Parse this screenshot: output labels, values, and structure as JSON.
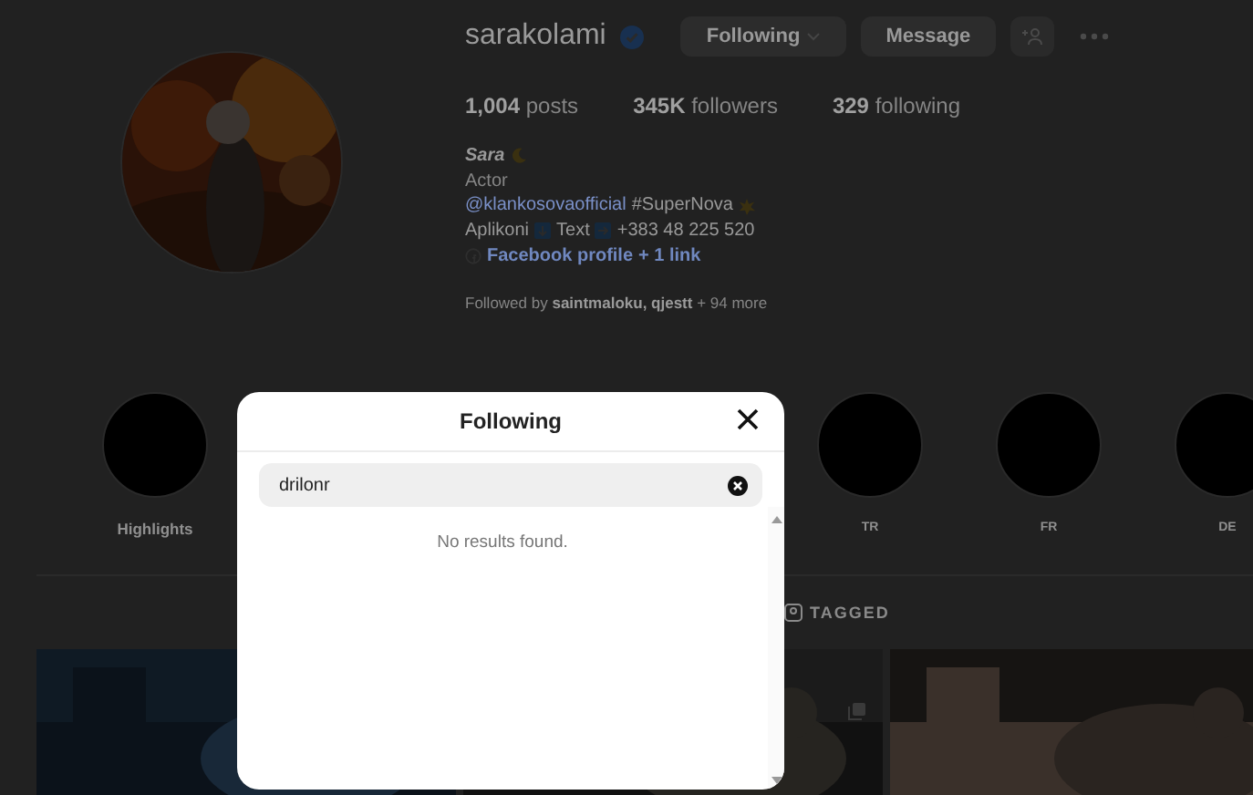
{
  "profile": {
    "username": "sarakolami",
    "verified": true,
    "buttons": [
      {
        "label": "Following",
        "kind": "dropdown"
      },
      {
        "label": "Message",
        "kind": "plain"
      }
    ],
    "stats": [
      {
        "value": "1,004",
        "label": "posts"
      },
      {
        "value": "345K",
        "label": "followers"
      },
      {
        "value": "329",
        "label": "following"
      }
    ],
    "bio": {
      "name": "Sara",
      "category": "Actor",
      "mention": "@klankosovaofficial",
      "hashtag": "#SuperNova",
      "contact": [
        "Aplikoni",
        "Text",
        "+383 48 225 520"
      ],
      "link": "Facebook profile",
      "link_more": "+ 1 link"
    },
    "followed_by": "Followed by **saintmaloku, qjestt** + 94 more"
  },
  "highlights": [
    {
      "label": "Highlights"
    },
    {
      "label": "TR"
    },
    {
      "label": "FR"
    },
    {
      "label": "DE"
    }
  ],
  "tabs": [
    {
      "label": "TAGGED",
      "selected": false
    }
  ],
  "modal": {
    "title": "Following",
    "search": {
      "value": "drilonr"
    },
    "empty_message": "No results found."
  }
}
